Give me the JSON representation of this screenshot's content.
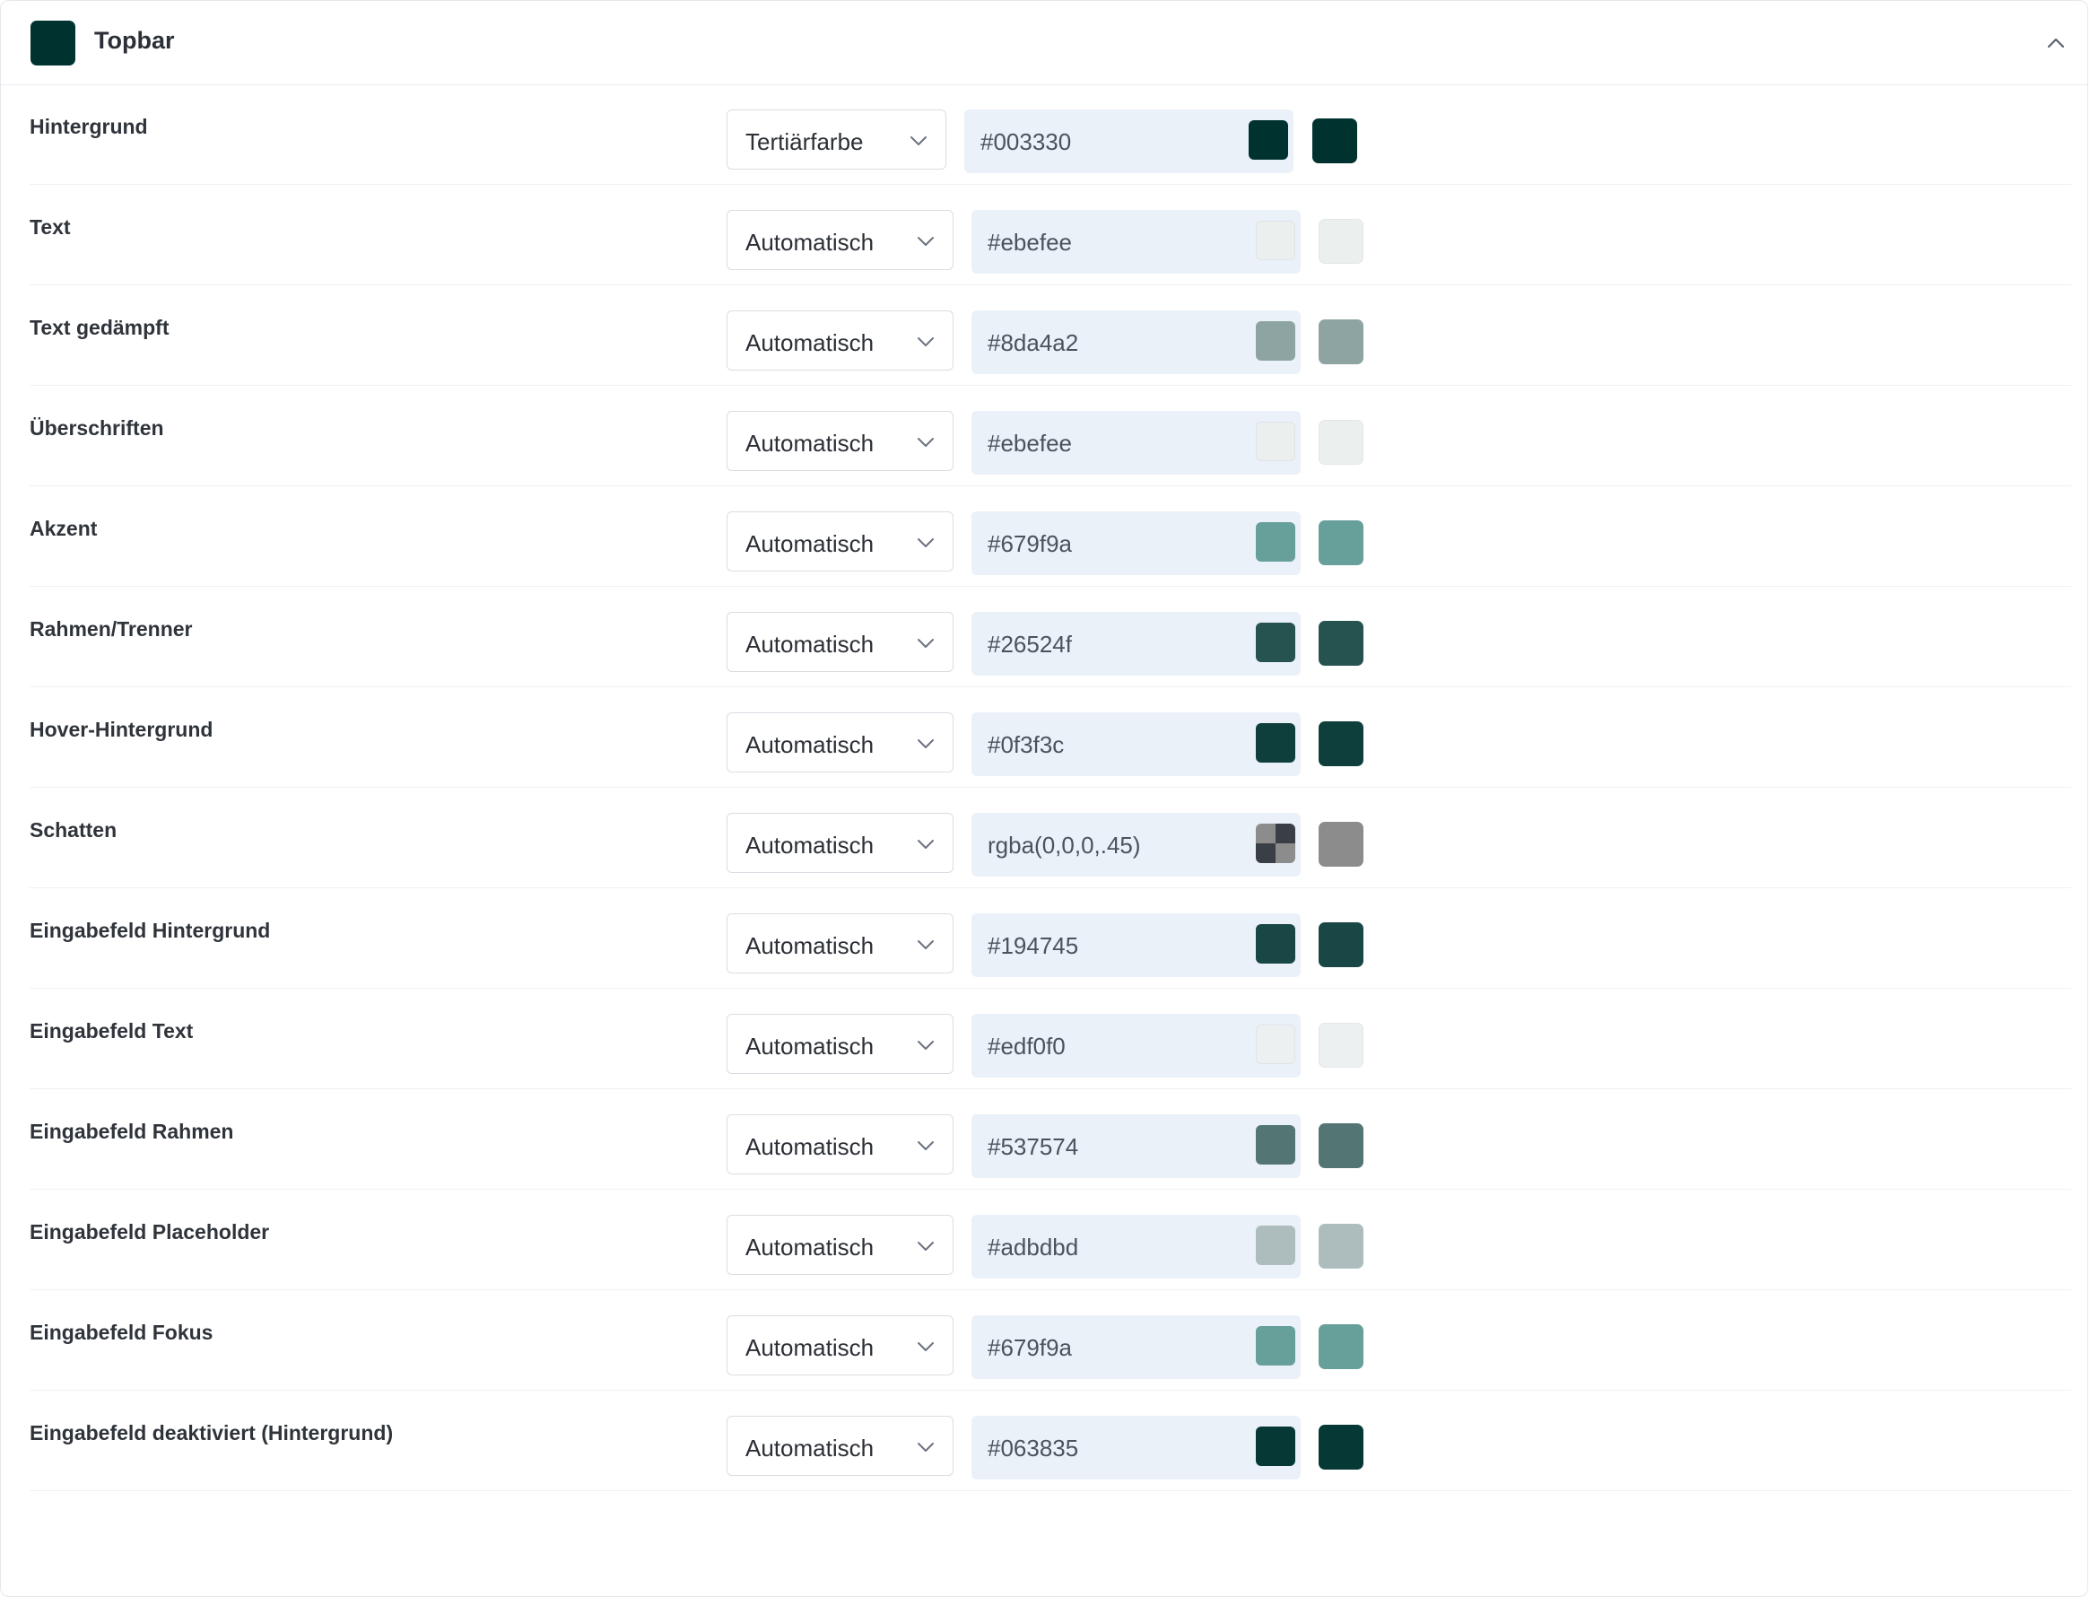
{
  "panel": {
    "title": "Topbar",
    "header_swatch_color": "#003330",
    "collapse_icon": "chevron-up-icon"
  },
  "rows": [
    {
      "label": "Hintergrund",
      "mode": "Tertiärfarbe",
      "value": "#003330",
      "color": "#003330",
      "light": false
    },
    {
      "label": "Text",
      "mode": "Automatisch",
      "value": "#ebefee",
      "color": "#ebefee",
      "light": true
    },
    {
      "label": "Text gedämpft",
      "mode": "Automatisch",
      "value": "#8da4a2",
      "color": "#8da4a2",
      "light": false
    },
    {
      "label": "Überschriften",
      "mode": "Automatisch",
      "value": "#ebefee",
      "color": "#ebefee",
      "light": true
    },
    {
      "label": "Akzent",
      "mode": "Automatisch",
      "value": "#679f9a",
      "color": "#679f9a",
      "light": false
    },
    {
      "label": "Rahmen/Trenner",
      "mode": "Automatisch",
      "value": "#26524f",
      "color": "#26524f",
      "light": false
    },
    {
      "label": "Hover-Hintergrund",
      "mode": "Automatisch",
      "value": "#0f3f3c",
      "color": "#0f3f3c",
      "light": false
    },
    {
      "label": "Schatten",
      "mode": "Automatisch",
      "value": "rgba(0,0,0,.45)",
      "color": "#8c8c8c",
      "light": false,
      "checker": true
    },
    {
      "label": "Eingabefeld Hintergrund",
      "mode": "Automatisch",
      "value": "#194745",
      "color": "#194745",
      "light": false
    },
    {
      "label": "Eingabefeld Text",
      "mode": "Automatisch",
      "value": "#edf0f0",
      "color": "#edf0f0",
      "light": true
    },
    {
      "label": "Eingabefeld Rahmen",
      "mode": "Automatisch",
      "value": "#537574",
      "color": "#537574",
      "light": false
    },
    {
      "label": "Eingabefeld Placeholder",
      "mode": "Automatisch",
      "value": "#adbdbd",
      "color": "#adbdbd",
      "light": false
    },
    {
      "label": "Eingabefeld Fokus",
      "mode": "Automatisch",
      "value": "#679f9a",
      "color": "#679f9a",
      "light": false
    },
    {
      "label": "Eingabefeld deaktiviert (Hintergrund)",
      "mode": "Automatisch",
      "value": "#063835",
      "color": "#063835",
      "light": false
    }
  ]
}
